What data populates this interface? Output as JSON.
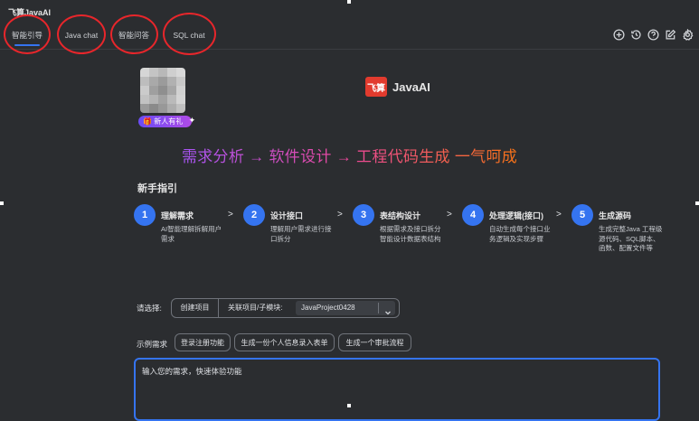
{
  "app": {
    "title": "飞算JavaAI"
  },
  "tabs": [
    {
      "label": "智能引导",
      "active": true
    },
    {
      "label": "Java chat",
      "active": false
    },
    {
      "label": "智能问答",
      "active": false
    },
    {
      "label": "SQL chat",
      "active": false
    }
  ],
  "toolbar_icons": [
    "add-circle-icon",
    "history-icon",
    "help-icon",
    "edit-icon",
    "settings-icon"
  ],
  "promo": {
    "badge": "新人有礼"
  },
  "brand": {
    "logo_mark": "飞算",
    "name": "JavaAI"
  },
  "tagline": "需求分析 → 软件设计 → 工程代码生成 一气呵成",
  "guide": {
    "title": "新手指引",
    "steps": [
      {
        "num": "1",
        "title": "理解需求",
        "desc": "AI智能理解拆解用户需求"
      },
      {
        "num": "2",
        "title": "设计接口",
        "desc": "理解用户需求进行接口拆分"
      },
      {
        "num": "3",
        "title": "表结构设计",
        "desc": "根据需求及接口拆分智能设计数据表结构"
      },
      {
        "num": "4",
        "title": "处理逻辑(接口)",
        "desc": "自动生成每个接口业务逻辑及实现步骤"
      },
      {
        "num": "5",
        "title": "生成源码",
        "desc": "生成完整Java 工程级源代码、SQL脚本、函数、配置文件等"
      }
    ],
    "arrow": ">"
  },
  "select": {
    "label": "请选择:",
    "create_button": "创建项目",
    "related_label": "关联项目/子模块:",
    "project_value": "JavaProject0428"
  },
  "examples": {
    "label": "示例需求",
    "chips": [
      "登录注册功能",
      "生成一份个人信息录入表单",
      "生成一个审批流程"
    ]
  },
  "input": {
    "placeholder": "输入您的需求，快速体验功能"
  },
  "colors": {
    "accent": "#3574f0",
    "annotation_ring": "#e8262b",
    "background": "#2b2d30"
  }
}
